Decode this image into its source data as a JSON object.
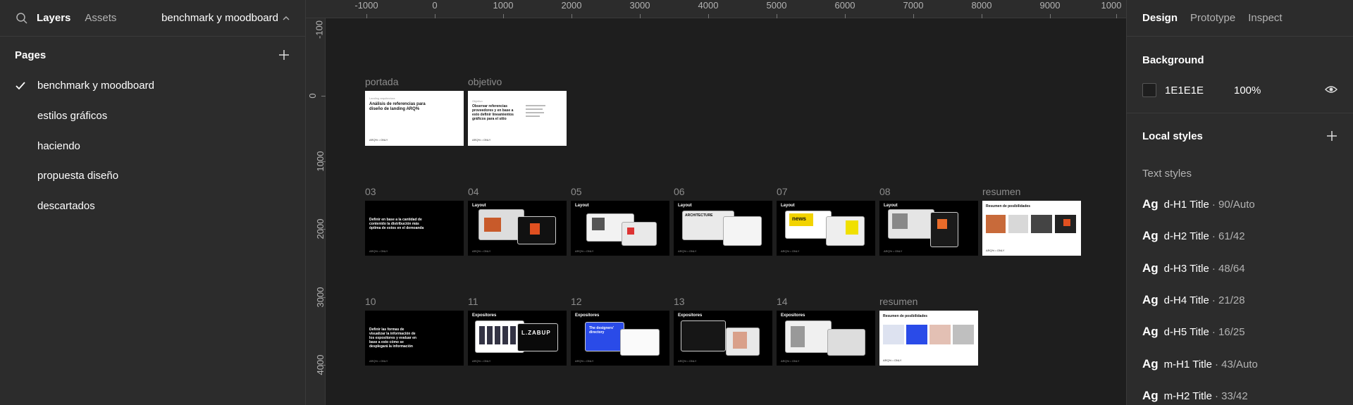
{
  "left_panel": {
    "tabs": {
      "layers": "Layers",
      "assets": "Assets"
    },
    "current_page": "benchmark y moodboard",
    "pages_title": "Pages",
    "pages": [
      {
        "label": "benchmark y moodboard",
        "active": true
      },
      {
        "label": "estilos gráficos",
        "active": false
      },
      {
        "label": "haciendo",
        "active": false
      },
      {
        "label": "propuesta diseño",
        "active": false
      },
      {
        "label": "descartados",
        "active": false
      }
    ]
  },
  "rulers": {
    "top": [
      "-1000",
      "0",
      "1000",
      "2000",
      "3000",
      "4000",
      "5000",
      "6000",
      "7000",
      "8000",
      "9000",
      "1000"
    ],
    "left": [
      "-100",
      "0",
      "1000",
      "2000",
      "3000",
      "4000"
    ]
  },
  "canvas": {
    "row1": [
      {
        "label": "portada",
        "heading": "Análisis de referencias para diseño de landing ARQ%",
        "kicker": "Landing arquitectura"
      },
      {
        "label": "objetivo",
        "heading": "Observar referencias proveedores y en base a esto definir lineamientos gráficos para el sitio",
        "kicker": "Objetivo"
      }
    ],
    "row2": [
      {
        "label": "03",
        "heading": "Definir en base a la cantidad de contenido la distribución más óptima de estos en el demoanda"
      },
      {
        "label": "04",
        "heading": "Layout"
      },
      {
        "label": "05",
        "heading": "Layout"
      },
      {
        "label": "06",
        "heading": "Layout",
        "shot": "ARCHITECTURE"
      },
      {
        "label": "07",
        "heading": "Layout",
        "shot": "news"
      },
      {
        "label": "08",
        "heading": "Layout"
      },
      {
        "label": "resumen",
        "heading": "Resumen de posibilidades"
      }
    ],
    "row3": [
      {
        "label": "10",
        "heading": "Definir las formas de visualizar la información de los expositores y evaluar en base a esto cómo se desplegará la información"
      },
      {
        "label": "11",
        "heading": "Expositores",
        "shot": "L.ZABUP"
      },
      {
        "label": "12",
        "heading": "Expositores",
        "shot": "The designers' directory"
      },
      {
        "label": "13",
        "heading": "Expositores"
      },
      {
        "label": "14",
        "heading": "Expositores"
      },
      {
        "label": "resumen",
        "heading": "Resumen de posibilidades"
      }
    ],
    "footer_mark": "ARQ% • ONLY"
  },
  "right_panel": {
    "tabs": {
      "design": "Design",
      "prototype": "Prototype",
      "inspect": "Inspect"
    },
    "background_title": "Background",
    "background_hex": "1E1E1E",
    "background_opacity": "100%",
    "local_styles_title": "Local styles",
    "text_styles_title": "Text styles",
    "text_styles": [
      {
        "ag": "Ag",
        "name": "d-H1 Title",
        "meta": "· 90/Auto"
      },
      {
        "ag": "Ag",
        "name": "d-H2 Title",
        "meta": "· 61/42"
      },
      {
        "ag": "Ag",
        "name": "d-H3 Title",
        "meta": "· 48/64"
      },
      {
        "ag": "Ag",
        "name": "d-H4 Title",
        "meta": "· 21/28"
      },
      {
        "ag": "Ag",
        "name": "d-H5 Title",
        "meta": "· 16/25"
      },
      {
        "ag": "Ag",
        "name": "m-H1 Title",
        "meta": "· 43/Auto"
      },
      {
        "ag": "Ag",
        "name": "m-H2 Title",
        "meta": "· 33/42"
      }
    ]
  },
  "colors": {
    "panel": "#2c2c2c",
    "canvas": "#1e1e1e",
    "accent": "#ffffff"
  }
}
